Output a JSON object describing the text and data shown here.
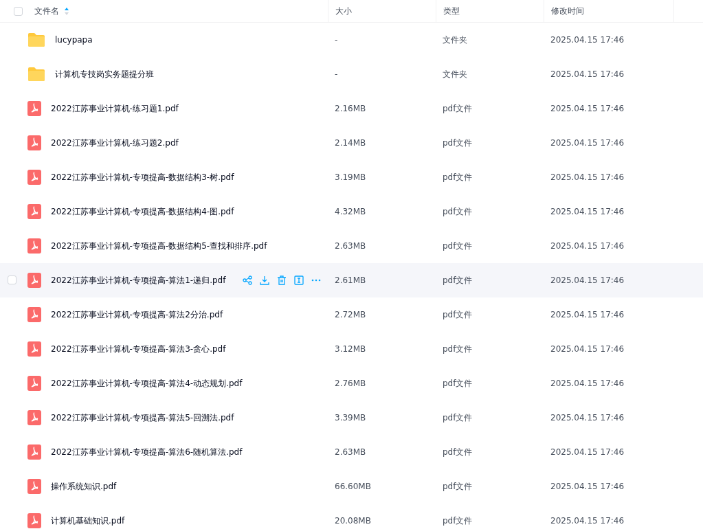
{
  "columns": [
    {
      "label": "文件名",
      "sorted": true
    },
    {
      "label": "大小",
      "sorted": false
    },
    {
      "label": "类型",
      "sorted": false
    },
    {
      "label": "修改时间",
      "sorted": false
    }
  ],
  "header_checked": false,
  "rows": [
    {
      "kind": "folder",
      "name": "lucypapa",
      "size": "-",
      "type": "文件夹",
      "modified": "2025.04.15 17:46",
      "hovered": false,
      "checked": false
    },
    {
      "kind": "folder",
      "name": "计算机专技岗实务题提分班",
      "size": "-",
      "type": "文件夹",
      "modified": "2025.04.15 17:46",
      "hovered": false,
      "checked": false
    },
    {
      "kind": "pdf",
      "name": "2022江苏事业计算机-练习题1.pdf",
      "size": "2.16MB",
      "type": "pdf文件",
      "modified": "2025.04.15 17:46",
      "hovered": false,
      "checked": false
    },
    {
      "kind": "pdf",
      "name": "2022江苏事业计算机-练习题2.pdf",
      "size": "2.14MB",
      "type": "pdf文件",
      "modified": "2025.04.15 17:46",
      "hovered": false,
      "checked": false
    },
    {
      "kind": "pdf",
      "name": "2022江苏事业计算机-专项提高-数据结构3-树.pdf",
      "size": "3.19MB",
      "type": "pdf文件",
      "modified": "2025.04.15 17:46",
      "hovered": false,
      "checked": false
    },
    {
      "kind": "pdf",
      "name": "2022江苏事业计算机-专项提高-数据结构4-图.pdf",
      "size": "4.32MB",
      "type": "pdf文件",
      "modified": "2025.04.15 17:46",
      "hovered": false,
      "checked": false
    },
    {
      "kind": "pdf",
      "name": "2022江苏事业计算机-专项提高-数据结构5-查找和排序.pdf",
      "size": "2.63MB",
      "type": "pdf文件",
      "modified": "2025.04.15 17:46",
      "hovered": false,
      "checked": false
    },
    {
      "kind": "pdf",
      "name": "2022江苏事业计算机-专项提高-算法1-递归.pdf",
      "size": "2.61MB",
      "type": "pdf文件",
      "modified": "2025.04.15 17:46",
      "hovered": true,
      "checked": false
    },
    {
      "kind": "pdf",
      "name": "2022江苏事业计算机-专项提高-算法2分治.pdf",
      "size": "2.72MB",
      "type": "pdf文件",
      "modified": "2025.04.15 17:46",
      "hovered": false,
      "checked": false
    },
    {
      "kind": "pdf",
      "name": "2022江苏事业计算机-专项提高-算法3-贪心.pdf",
      "size": "3.12MB",
      "type": "pdf文件",
      "modified": "2025.04.15 17:46",
      "hovered": false,
      "checked": false
    },
    {
      "kind": "pdf",
      "name": "2022江苏事业计算机-专项提高-算法4-动态规划.pdf",
      "size": "2.76MB",
      "type": "pdf文件",
      "modified": "2025.04.15 17:46",
      "hovered": false,
      "checked": false
    },
    {
      "kind": "pdf",
      "name": "2022江苏事业计算机-专项提高-算法5-回溯法.pdf",
      "size": "3.39MB",
      "type": "pdf文件",
      "modified": "2025.04.15 17:46",
      "hovered": false,
      "checked": false
    },
    {
      "kind": "pdf",
      "name": "2022江苏事业计算机-专项提高-算法6-随机算法.pdf",
      "size": "2.63MB",
      "type": "pdf文件",
      "modified": "2025.04.15 17:46",
      "hovered": false,
      "checked": false
    },
    {
      "kind": "pdf",
      "name": "操作系统知识.pdf",
      "size": "66.60MB",
      "type": "pdf文件",
      "modified": "2025.04.15 17:46",
      "hovered": false,
      "checked": false
    },
    {
      "kind": "pdf",
      "name": "计算机基础知识.pdf",
      "size": "20.08MB",
      "type": "pdf文件",
      "modified": "2025.04.15 17:46",
      "hovered": false,
      "checked": false
    }
  ]
}
